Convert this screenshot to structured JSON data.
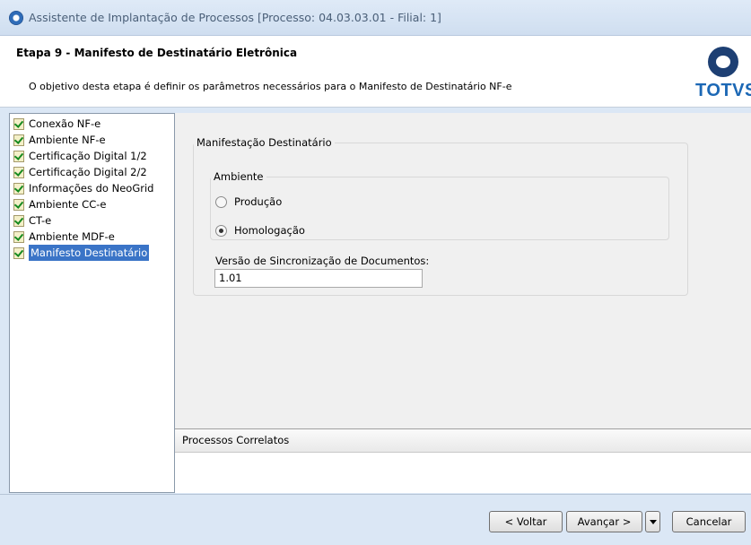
{
  "window": {
    "title": "Assistente de Implantação de Processos [Processo: 04.03.03.01 - Filial: 1]",
    "icon": "app-globe-icon"
  },
  "header": {
    "step_title": "Etapa 9 - Manifesto de Destinatário Eletrônica",
    "description": "O objetivo desta etapa é definir os parâmetros necessários para o Manifesto de Destinatário NF-e",
    "logo_text": "TOTVS",
    "logo_color": "#1c68b5"
  },
  "steps": [
    {
      "label": "Conexão NF-e",
      "completed": true
    },
    {
      "label": "Ambiente NF-e",
      "completed": true
    },
    {
      "label": "Certificação Digital 1/2",
      "completed": true
    },
    {
      "label": "Certificação Digital 2/2",
      "completed": true
    },
    {
      "label": "Informações do NeoGrid",
      "completed": true
    },
    {
      "label": "Ambiente CC-e",
      "completed": true
    },
    {
      "label": "CT-e",
      "completed": true
    },
    {
      "label": "Ambiente MDF-e",
      "completed": true
    },
    {
      "label": "Manifesto Destinatário",
      "completed": true,
      "selected": true
    }
  ],
  "form": {
    "group_title": "Manifestação Destinatário",
    "ambiente": {
      "title": "Ambiente",
      "options": [
        "Produção",
        "Homologação"
      ],
      "selected": "Homologação"
    },
    "versao_label": "Versão de Sincronização de Documentos:",
    "versao_value": "1.01"
  },
  "related": {
    "title": "Processos Correlatos"
  },
  "buttons": {
    "back": "< Voltar",
    "next": "Avançar >",
    "cancel": "Cancelar"
  },
  "colors": {
    "selection": "#3a74c7",
    "titlebar": "#dfeaf7"
  }
}
